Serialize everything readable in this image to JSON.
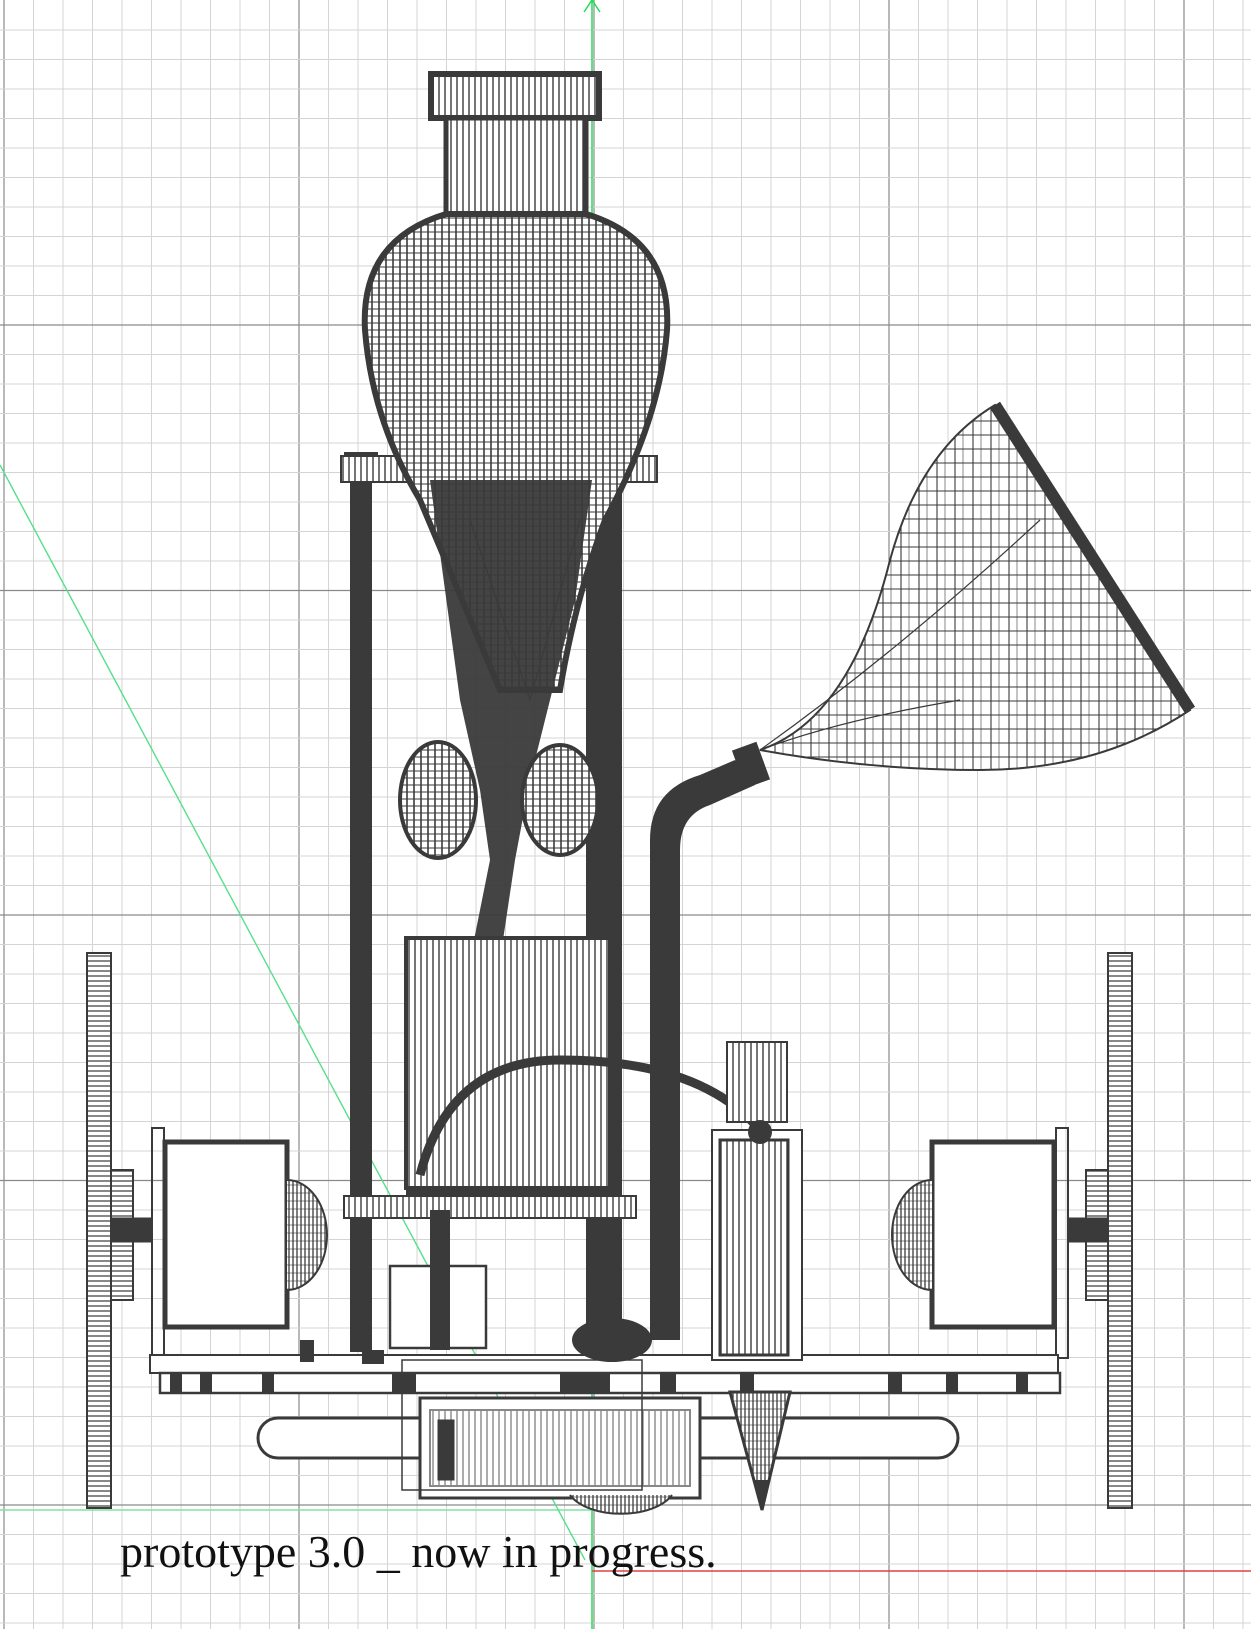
{
  "caption": "prototype 3.0 _ now in progress.",
  "colors": {
    "background": "#ffffff",
    "grid_minor": "#d4d4d4",
    "grid_major": "#8a8a8a",
    "axis_y": "#22dd55",
    "axis_x_green": "#7fe3a6",
    "axis_x_red": "#e04040",
    "ink": "#3a3a3a",
    "guide": "#55e08a"
  }
}
